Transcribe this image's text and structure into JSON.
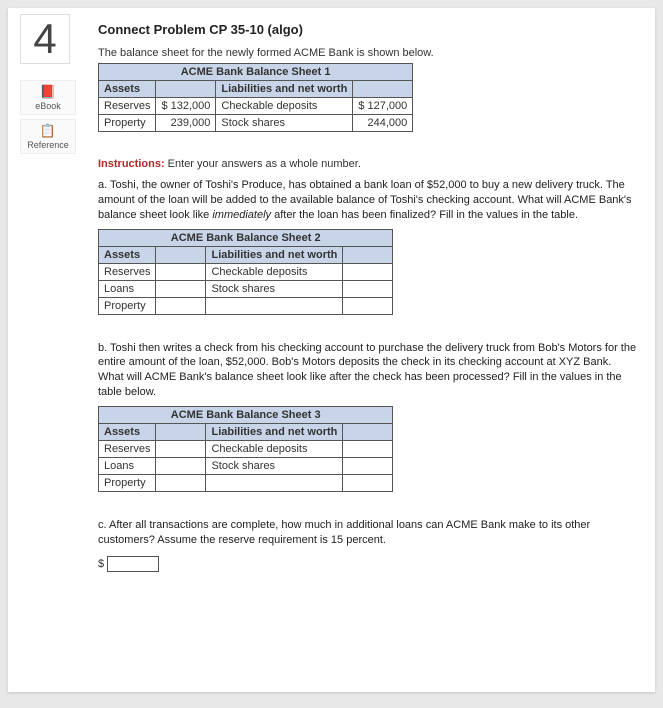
{
  "step_number": "4",
  "sidebar": {
    "ebook": {
      "label": "eBook"
    },
    "reference": {
      "label": "Reference"
    }
  },
  "title": "Connect Problem CP 35-10 (algo)",
  "intro": "The balance sheet for the newly formed ACME Bank is shown below.",
  "sheet1": {
    "caption": "ACME Bank Balance Sheet 1",
    "assets_hdr": "Assets",
    "liab_hdr": "Liabilities and net worth",
    "rows": {
      "reserves_label": "Reserves",
      "reserves_val": "$ 132,000",
      "checkable_label": "Checkable deposits",
      "checkable_val": "$ 127,000",
      "property_label": "Property",
      "property_val": "239,000",
      "stock_label": "Stock shares",
      "stock_val": "244,000"
    }
  },
  "instructions_label": "Instructions:",
  "instructions_text": " Enter your answers as a whole number.",
  "part_a": "a. Toshi, the owner of Toshi's Produce, has obtained a bank loan of $52,000 to buy a new delivery truck. The amount of the loan will be added to the available balance of Toshi's checking account. What will ACME Bank's balance sheet look like ",
  "part_a_ital": "immediately",
  "part_a_rest": " after the loan has been finalized? Fill in the values in the table.",
  "sheet2": {
    "caption": "ACME Bank Balance Sheet 2",
    "assets_hdr": "Assets",
    "liab_hdr": "Liabilities and net worth",
    "reserves": "Reserves",
    "loans": "Loans",
    "property": "Property",
    "checkable": "Checkable deposits",
    "stock": "Stock shares"
  },
  "part_b": "b. Toshi then writes a check from his checking account to purchase the delivery truck from Bob's Motors for the entire amount of the loan, $52,000. Bob's Motors deposits the check in its checking account at XYZ Bank. What will ACME Bank's balance sheet look like after the check has been processed? Fill in the values in the table below.",
  "sheet3": {
    "caption": "ACME Bank Balance Sheet 3",
    "assets_hdr": "Assets",
    "liab_hdr": "Liabilities and net worth",
    "reserves": "Reserves",
    "loans": "Loans",
    "property": "Property",
    "checkable": "Checkable deposits",
    "stock": "Stock shares"
  },
  "part_c": "c. After all transactions are complete, how much in additional loans can ACME Bank make to its other customers? Assume the reserve requirement is 15 percent.",
  "dollar_sign": "$"
}
